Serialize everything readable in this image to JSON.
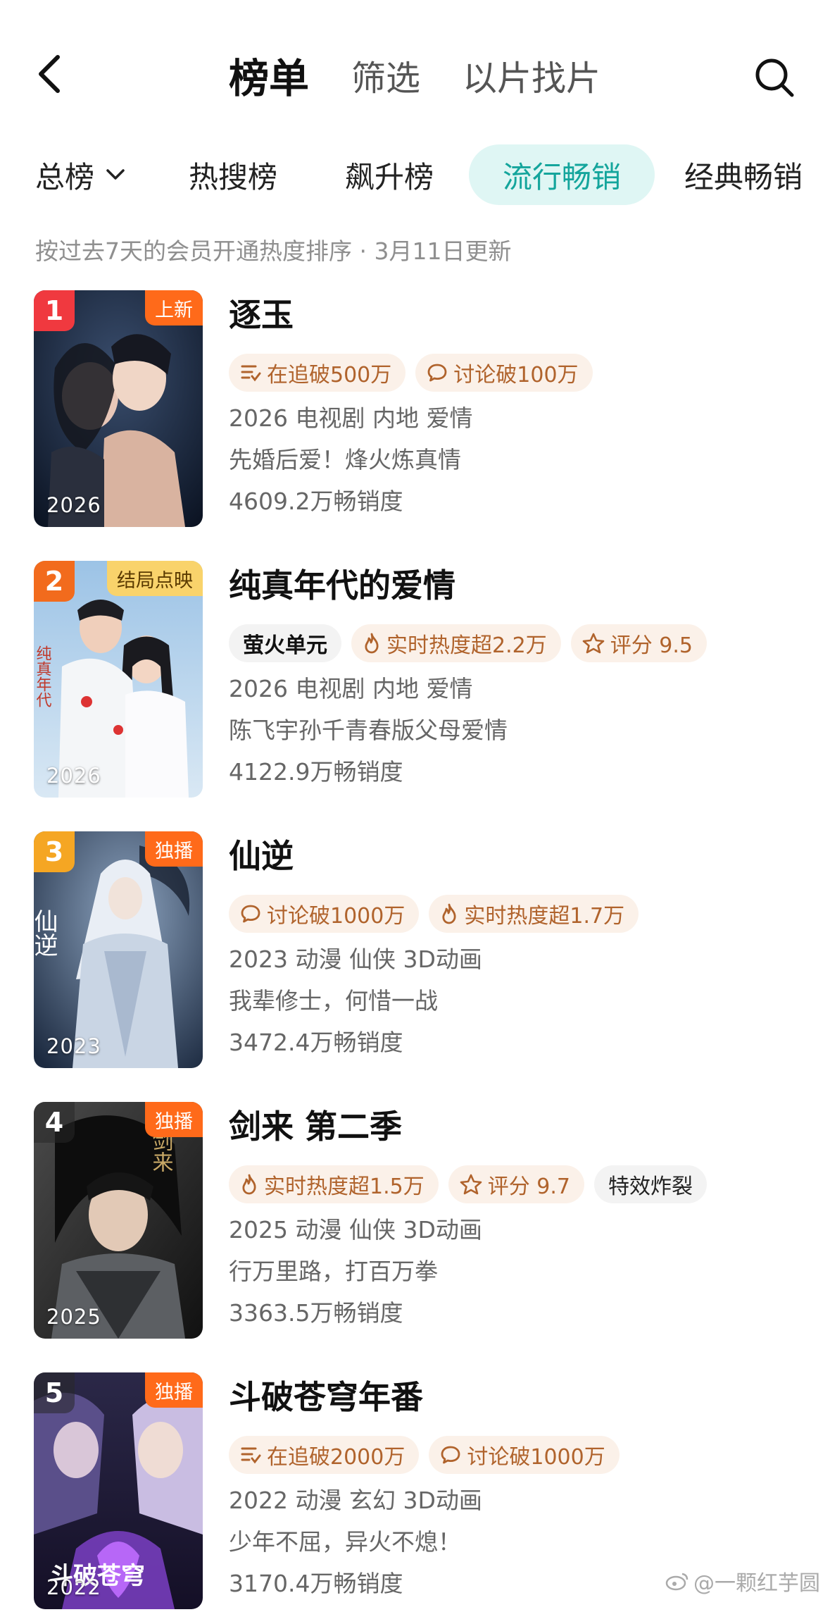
{
  "nav": {
    "tabs": [
      "榜单",
      "筛选",
      "以片找片"
    ]
  },
  "categories": [
    "总榜",
    "热搜榜",
    "飙升榜",
    "流行畅销",
    "经典畅销"
  ],
  "update_note": "按过去7天的会员开通热度排序 · 3月11日更新",
  "accent_color": "#14a59c",
  "items": [
    {
      "rank": "1",
      "rank_color": "#f0393f",
      "corner_tag": "上新",
      "corner_style": "orange",
      "poster_year": "2026",
      "title": "逐玉",
      "chips": [
        {
          "icon": "list-icon",
          "text": "在追破500万"
        },
        {
          "icon": "comment-icon",
          "text": "讨论破100万"
        }
      ],
      "meta": "2026 电视剧 内地 爱情",
      "desc": "先婚后爱！烽火炼真情",
      "sales": "4609.2万畅销度"
    },
    {
      "rank": "2",
      "rank_color": "#f26b1d",
      "corner_tag": "结局点映",
      "corner_style": "gold",
      "poster_year": "2026",
      "title": "纯真年代的爱情",
      "chips": [
        {
          "icon": "",
          "text": "萤火单元",
          "style": "logo"
        },
        {
          "icon": "flame-icon",
          "text": "实时热度超2.2万"
        },
        {
          "icon": "star-icon",
          "text": "评分 9.5"
        }
      ],
      "meta": "2026 电视剧 内地 爱情",
      "desc": "陈飞宇孙千青春版父母爱情",
      "sales": "4122.9万畅销度"
    },
    {
      "rank": "3",
      "rank_color": "#f5a623",
      "corner_tag": "独播",
      "corner_style": "orange",
      "poster_year": "2023",
      "title": "仙逆",
      "chips": [
        {
          "icon": "comment-icon",
          "text": "讨论破1000万"
        },
        {
          "icon": "flame-icon",
          "text": "实时热度超1.7万"
        }
      ],
      "meta": "2023 动漫 仙侠 3D动画",
      "desc": "我辈修士，何惜一战",
      "sales": "3472.4万畅销度"
    },
    {
      "rank": "4",
      "rank_color": "rgba(40,40,40,0.55)",
      "corner_tag": "独播",
      "corner_style": "orange",
      "poster_year": "2025",
      "title": "剑来 第二季",
      "chips": [
        {
          "icon": "flame-icon",
          "text": "实时热度超1.5万"
        },
        {
          "icon": "star-icon",
          "text": "评分 9.7"
        },
        {
          "icon": "",
          "text": "特效炸裂",
          "style": "plain"
        }
      ],
      "meta": "2025 动漫 仙侠 3D动画",
      "desc": "行万里路，打百万拳",
      "sales": "3363.5万畅销度"
    },
    {
      "rank": "5",
      "rank_color": "rgba(40,40,40,0.55)",
      "corner_tag": "独播",
      "corner_style": "orange",
      "poster_year": "2022",
      "title": "斗破苍穹年番",
      "chips": [
        {
          "icon": "list-icon",
          "text": "在追破2000万"
        },
        {
          "icon": "comment-icon",
          "text": "讨论破1000万"
        }
      ],
      "meta": "2022 动漫 玄幻 3D动画",
      "desc": "少年不屈，异火不熄！",
      "sales": "3170.4万畅销度"
    }
  ],
  "watermark": "@一颗红芋圆"
}
